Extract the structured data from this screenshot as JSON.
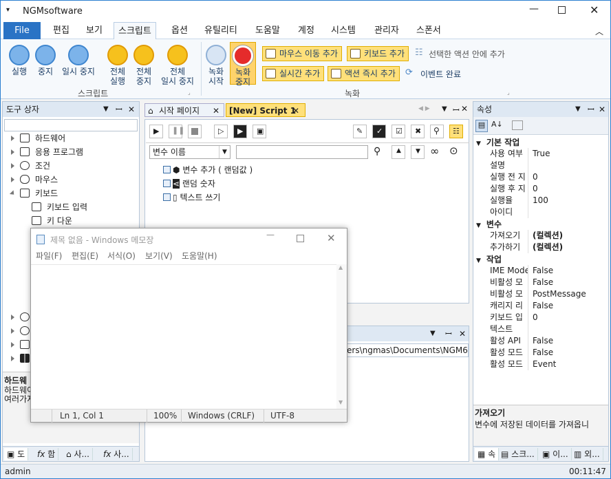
{
  "app": {
    "title": "NGMsoftware"
  },
  "menu": [
    "File",
    "편집",
    "보기",
    "스크립트",
    "옵션",
    "유틸리티",
    "도움말",
    "계정",
    "시스템",
    "관리자",
    "스폰서"
  ],
  "ribbon": {
    "script_buttons": [
      "실행",
      "중지",
      "일시 중지"
    ],
    "all_buttons": [
      {
        "l1": "전체",
        "l2": "실행"
      },
      {
        "l1": "전체",
        "l2": "중지"
      },
      {
        "l1": "전체",
        "l2": "일시 중지"
      }
    ],
    "script_group": "스크립트",
    "record_start": {
      "l1": "녹화",
      "l2": "시작"
    },
    "record_stop": {
      "l1": "녹화",
      "l2": "중지"
    },
    "chips": [
      "마우스 이동 추가",
      "키보드 추가",
      "실시간 추가",
      "액션 즉시 추가"
    ],
    "actions_in_selection": "선택한 액션 안에 추가",
    "event_done": "이벤트 완료",
    "record_group": "녹화"
  },
  "toolbox": {
    "title": "도구 상자",
    "items": [
      "하드웨어",
      "응용 프로그램",
      "조건",
      "마우스",
      "키보드"
    ],
    "sub": [
      "키보드 입력",
      "키 다운"
    ],
    "desc_title": "하드웨",
    "desc_lines": [
      "하드웨어",
      "여러가지"
    ],
    "bottom_tabs": [
      "도",
      "함",
      "사...",
      "사..."
    ]
  },
  "editor": {
    "tabs": [
      "시작 페이지",
      "[New] Script 1"
    ],
    "var_select": "변수 이름",
    "steps": [
      "변수 추가 ( 랜덤값 )",
      "랜덤 숫자",
      "텍스트 쓰기"
    ]
  },
  "lower": {
    "path": "ers\\ngmas\\Documents\\NGM6\\"
  },
  "properties": {
    "title": "속성",
    "sections": [
      {
        "name": "기본 작업",
        "rows": [
          [
            "사용 여부",
            "True"
          ],
          [
            "설명",
            ""
          ],
          [
            "실행 전 지",
            "0"
          ],
          [
            "실행 후 지",
            "0"
          ],
          [
            "실행율",
            "100"
          ],
          [
            "아이디",
            ""
          ]
        ]
      },
      {
        "name": "변수",
        "rows": [
          [
            "가져오기",
            "(컬렉션)"
          ],
          [
            "추가하기",
            "(컬렉션)"
          ]
        ]
      },
      {
        "name": "작업",
        "rows": [
          [
            "IME Mode",
            "False"
          ],
          [
            "비활성 모",
            "False"
          ],
          [
            "비활성 모",
            "PostMessage"
          ],
          [
            "캐리지 리",
            "False"
          ],
          [
            "키보드 입",
            "0"
          ],
          [
            "텍스트",
            ""
          ],
          [
            "활성 API",
            "False"
          ],
          [
            "활성 모드",
            "False"
          ],
          [
            "활성 모드",
            "Event"
          ]
        ]
      }
    ],
    "desc_title": "가져오기",
    "desc_text": "변수에 저장된 데이터를 가져옵니",
    "bottom_tabs": [
      "속",
      "스크...",
      "이...",
      "외..."
    ]
  },
  "notepad": {
    "title": "제목 없음 - Windows 메모장",
    "menu": [
      "파일(F)",
      "편집(E)",
      "서식(O)",
      "보기(V)",
      "도움말(H)"
    ],
    "status": [
      "Ln 1, Col 1",
      "100%",
      "Windows (CRLF)",
      "UTF-8"
    ]
  },
  "statusbar": {
    "user": "admin",
    "time": "00:11:47"
  }
}
